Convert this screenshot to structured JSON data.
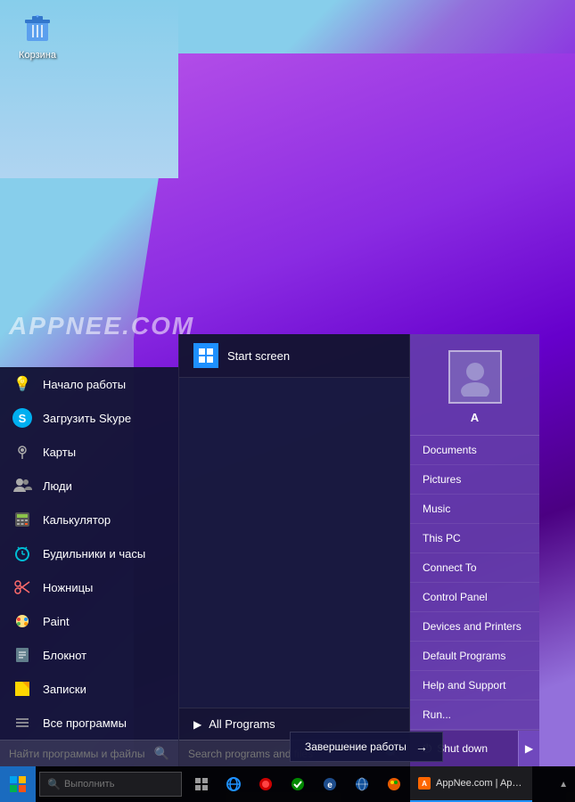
{
  "desktop": {
    "icon_recycle_bin": "Корзина"
  },
  "watermark": "APPNEE.COM",
  "start_menu": {
    "apps": [
      {
        "id": "startup",
        "label": "Начало работы",
        "icon": "💡"
      },
      {
        "id": "skype",
        "label": "Загрузить Skype",
        "icon": "S"
      },
      {
        "id": "maps",
        "label": "Карты",
        "icon": "👤"
      },
      {
        "id": "people",
        "label": "Люди",
        "icon": "👥"
      },
      {
        "id": "calculator",
        "label": "Калькулятор",
        "icon": "🧮"
      },
      {
        "id": "alarms",
        "label": "Будильники и часы",
        "icon": "⏰"
      },
      {
        "id": "scissors",
        "label": "Ножницы",
        "icon": "✂"
      },
      {
        "id": "paint",
        "label": "Paint",
        "icon": "🎨"
      },
      {
        "id": "notepad",
        "label": "Блокнот",
        "icon": "📋"
      },
      {
        "id": "stickynotes",
        "label": "Записки",
        "icon": "📌"
      },
      {
        "id": "allprograms",
        "label": "Все программы",
        "icon": "☰"
      }
    ],
    "search_placeholder": "Найти программы и файлы"
  },
  "middle_panel": {
    "start_screen_label": "Start screen",
    "all_programs_label": "All Programs",
    "search_placeholder": "Search programs and files"
  },
  "right_panel": {
    "username": "A",
    "items": [
      {
        "id": "documents",
        "label": "Documents"
      },
      {
        "id": "pictures",
        "label": "Pictures"
      },
      {
        "id": "music",
        "label": "Music"
      },
      {
        "id": "this_pc",
        "label": "This PC"
      },
      {
        "id": "connect_to",
        "label": "Connect To"
      },
      {
        "id": "control_panel",
        "label": "Control Panel"
      },
      {
        "id": "devices_printers",
        "label": "Devices and Printers"
      },
      {
        "id": "default_programs",
        "label": "Default Programs"
      },
      {
        "id": "help_support",
        "label": "Help and Support"
      },
      {
        "id": "run",
        "label": "Run..."
      }
    ],
    "shutdown_label": "Shut down"
  },
  "taskbar": {
    "search_placeholder": "Выполнить",
    "app_label": "AppNee.com | AppN...",
    "notification_label": "Завершение работы"
  },
  "notification": {
    "label": "Завершение работы",
    "icon": "→"
  },
  "icons": {
    "search": "🔍",
    "arrow_right": "▶",
    "chevron_right": "›"
  }
}
